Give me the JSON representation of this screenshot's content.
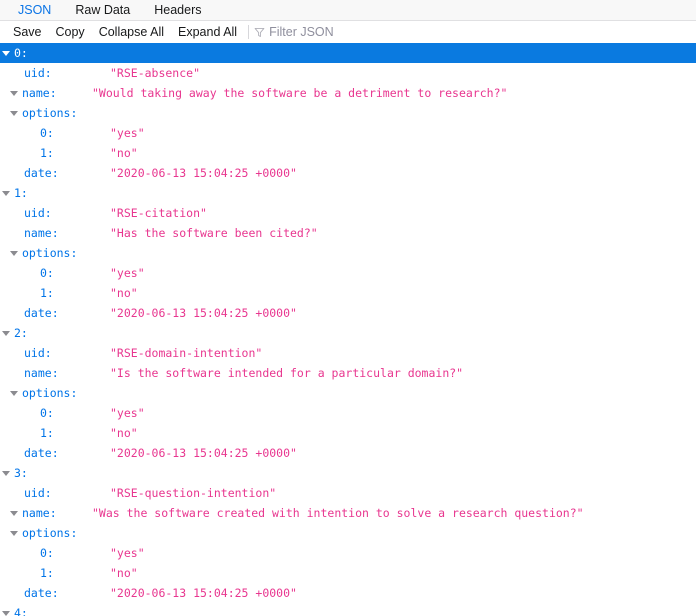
{
  "tabs": [
    {
      "label": "JSON",
      "active": true
    },
    {
      "label": "Raw Data",
      "active": false
    },
    {
      "label": "Headers",
      "active": false
    }
  ],
  "toolbar": {
    "save_label": "Save",
    "copy_label": "Copy",
    "collapse_all_label": "Collapse All",
    "expand_all_label": "Expand All",
    "filter_placeholder": "Filter JSON",
    "filter_value": "",
    "filter_icon": "funnel-icon"
  },
  "colors": {
    "key": "#0074e8",
    "string": "#e8368f",
    "selection_bg": "#0a7ae0",
    "tab_active": "#0a74e6",
    "tabbar_bg": "#f8f8f8"
  },
  "json": {
    "selected_index": 0,
    "items": [
      {
        "index": "0:",
        "uid_key": "uid:",
        "uid_value": "\"RSE-absence\"",
        "name_key": "name:",
        "name_value": "\"Would taking away the software be a detriment to research?\"",
        "name_expandable": true,
        "options_key": "options:",
        "options": [
          {
            "index": "0:",
            "value": "\"yes\""
          },
          {
            "index": "1:",
            "value": "\"no\""
          }
        ],
        "date_key": "date:",
        "date_value": "\"2020-06-13 15:04:25 +0000\""
      },
      {
        "index": "1:",
        "uid_key": "uid:",
        "uid_value": "\"RSE-citation\"",
        "name_key": "name:",
        "name_value": "\"Has the software been cited?\"",
        "name_expandable": false,
        "options_key": "options:",
        "options": [
          {
            "index": "0:",
            "value": "\"yes\""
          },
          {
            "index": "1:",
            "value": "\"no\""
          }
        ],
        "date_key": "date:",
        "date_value": "\"2020-06-13 15:04:25 +0000\""
      },
      {
        "index": "2:",
        "uid_key": "uid:",
        "uid_value": "\"RSE-domain-intention\"",
        "name_key": "name:",
        "name_value": "\"Is the software intended for a particular domain?\"",
        "name_expandable": false,
        "options_key": "options:",
        "options": [
          {
            "index": "0:",
            "value": "\"yes\""
          },
          {
            "index": "1:",
            "value": "\"no\""
          }
        ],
        "date_key": "date:",
        "date_value": "\"2020-06-13 15:04:25 +0000\""
      },
      {
        "index": "3:",
        "uid_key": "uid:",
        "uid_value": "\"RSE-question-intention\"",
        "name_key": "name:",
        "name_value": "\"Was the software created with intention to solve a research question?\"",
        "name_expandable": true,
        "options_key": "options:",
        "options": [
          {
            "index": "0:",
            "value": "\"yes\""
          },
          {
            "index": "1:",
            "value": "\"no\""
          }
        ],
        "date_key": "date:",
        "date_value": "\"2020-06-13 15:04:25 +0000\""
      }
    ],
    "next_item_index": "4:"
  }
}
